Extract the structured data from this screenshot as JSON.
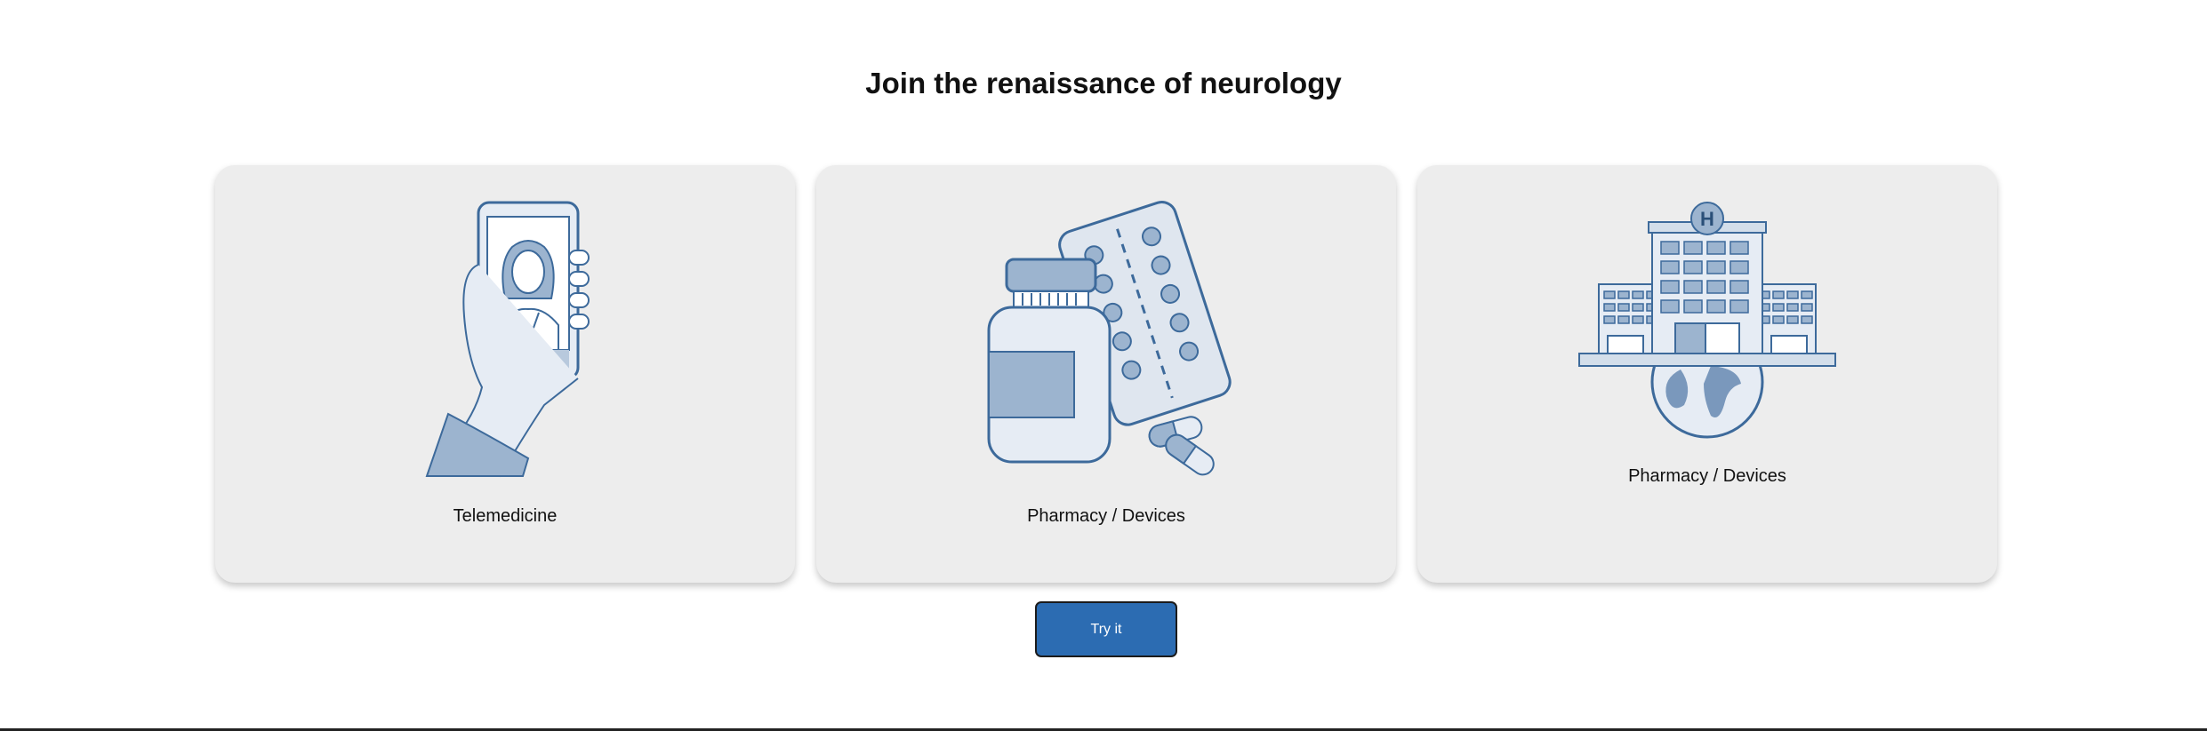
{
  "page": {
    "heading": "Join the renaissance of neurology"
  },
  "cards": [
    {
      "label": "Telemedicine",
      "icon": "telemedicine-phone-doctor-illustration"
    },
    {
      "label": "Pharmacy / Devices",
      "icon": "pill-bottle-blister-pack-illustration"
    },
    {
      "label": "Pharmacy / Devices",
      "icon": "hospital-globe-illustration"
    }
  ],
  "cta": {
    "label": "Try it"
  },
  "colors": {
    "card_bg": "#ededed",
    "illustration_stroke": "#3d6a9b",
    "illustration_fill": "#9cb4cf",
    "illustration_light": "#e6ecf4",
    "button_bg": "#2c6cb2"
  }
}
